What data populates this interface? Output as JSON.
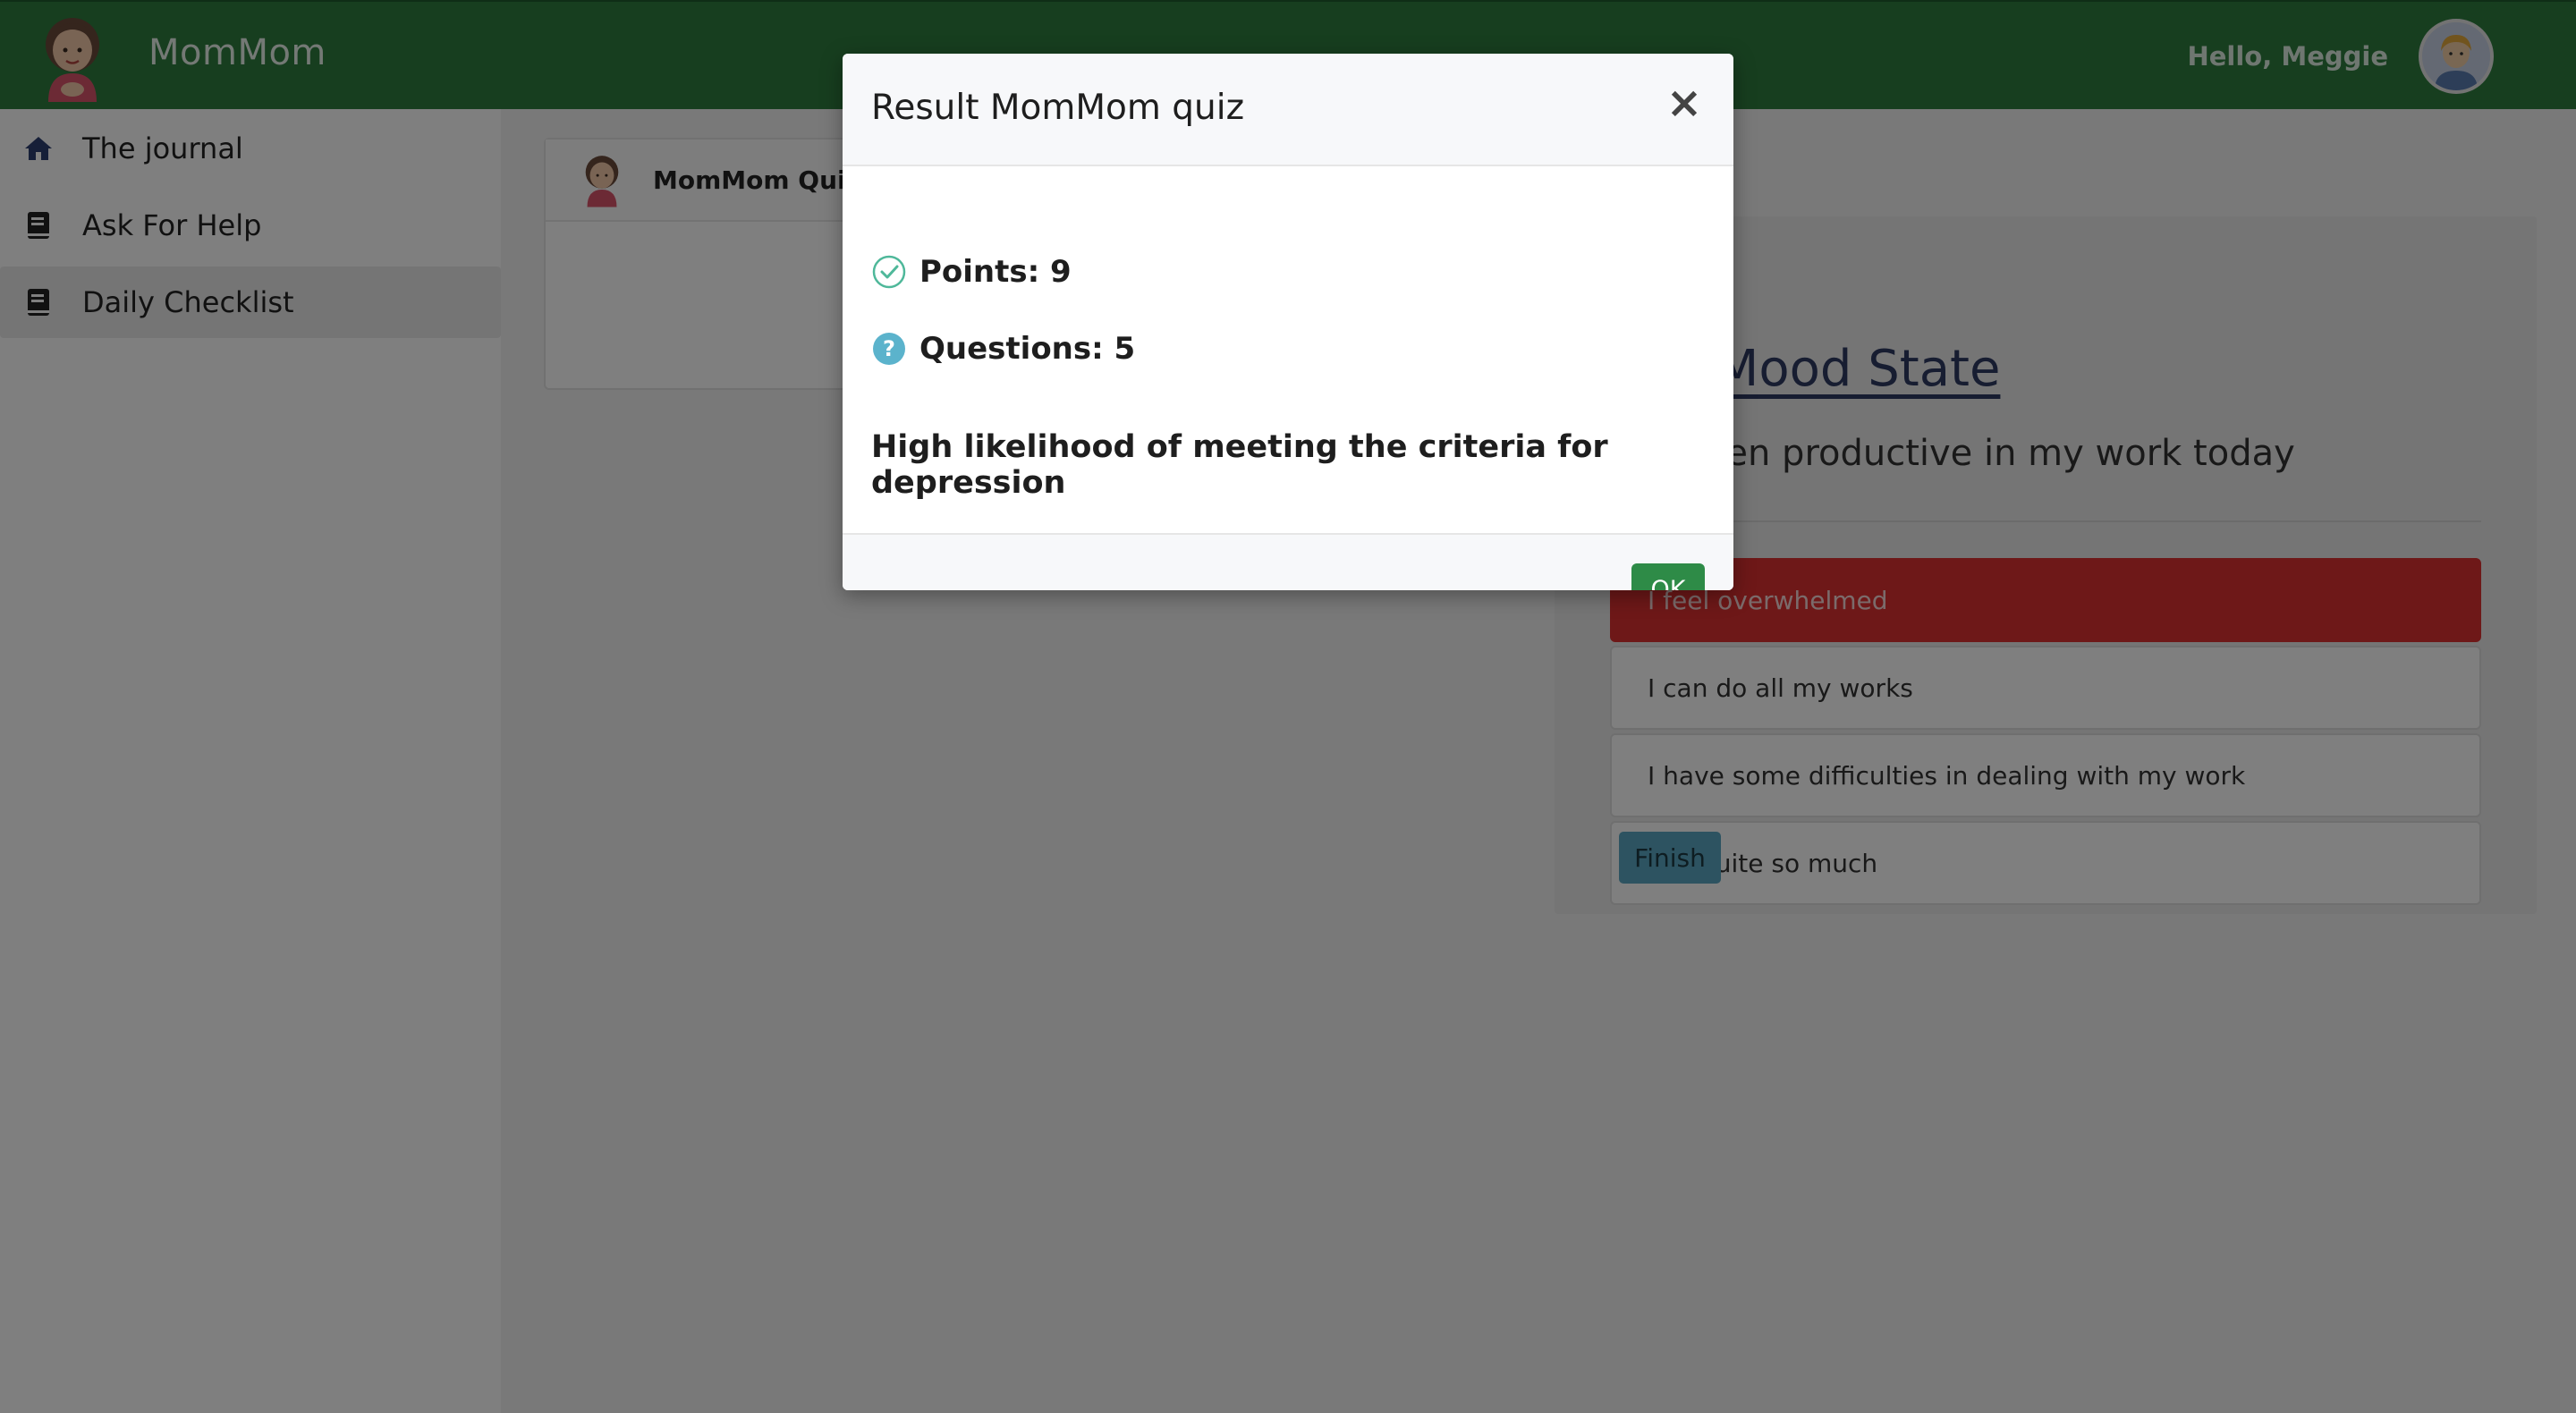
{
  "app": {
    "brand_name": "MomMom",
    "greeting": "Hello, Meggie"
  },
  "sidebar": {
    "items": [
      {
        "label": "The journal",
        "icon": "home-icon"
      },
      {
        "label": "Ask For Help",
        "icon": "book-icon"
      },
      {
        "label": "Daily Checklist",
        "icon": "book-icon",
        "active": true
      }
    ]
  },
  "quiz_card": {
    "title": "MomMom Quiz"
  },
  "mood": {
    "title": "Mood State",
    "question": "I have been productive in my work today",
    "options": [
      "I feel overwhelmed",
      "I can do all my works",
      "I have some difficulties in dealing with my work",
      "Not quite so much"
    ],
    "selected_index": 0,
    "finish_label": "Finish"
  },
  "modal": {
    "title": "Result MomMom quiz",
    "close_glyph": "×",
    "points_label": "Points: 9",
    "questions_label": "Questions: 5",
    "verdict": "High likelihood of meeting the criteria for depression",
    "ok_label": "OK"
  },
  "colors": {
    "nav_green": "#2e7d3f",
    "selected_red": "#dc3030",
    "ok_green": "#2e8b47",
    "finish_blue": "#5aa7c2",
    "check_teal": "#4fb89a",
    "question_blue": "#5bb3cc"
  }
}
